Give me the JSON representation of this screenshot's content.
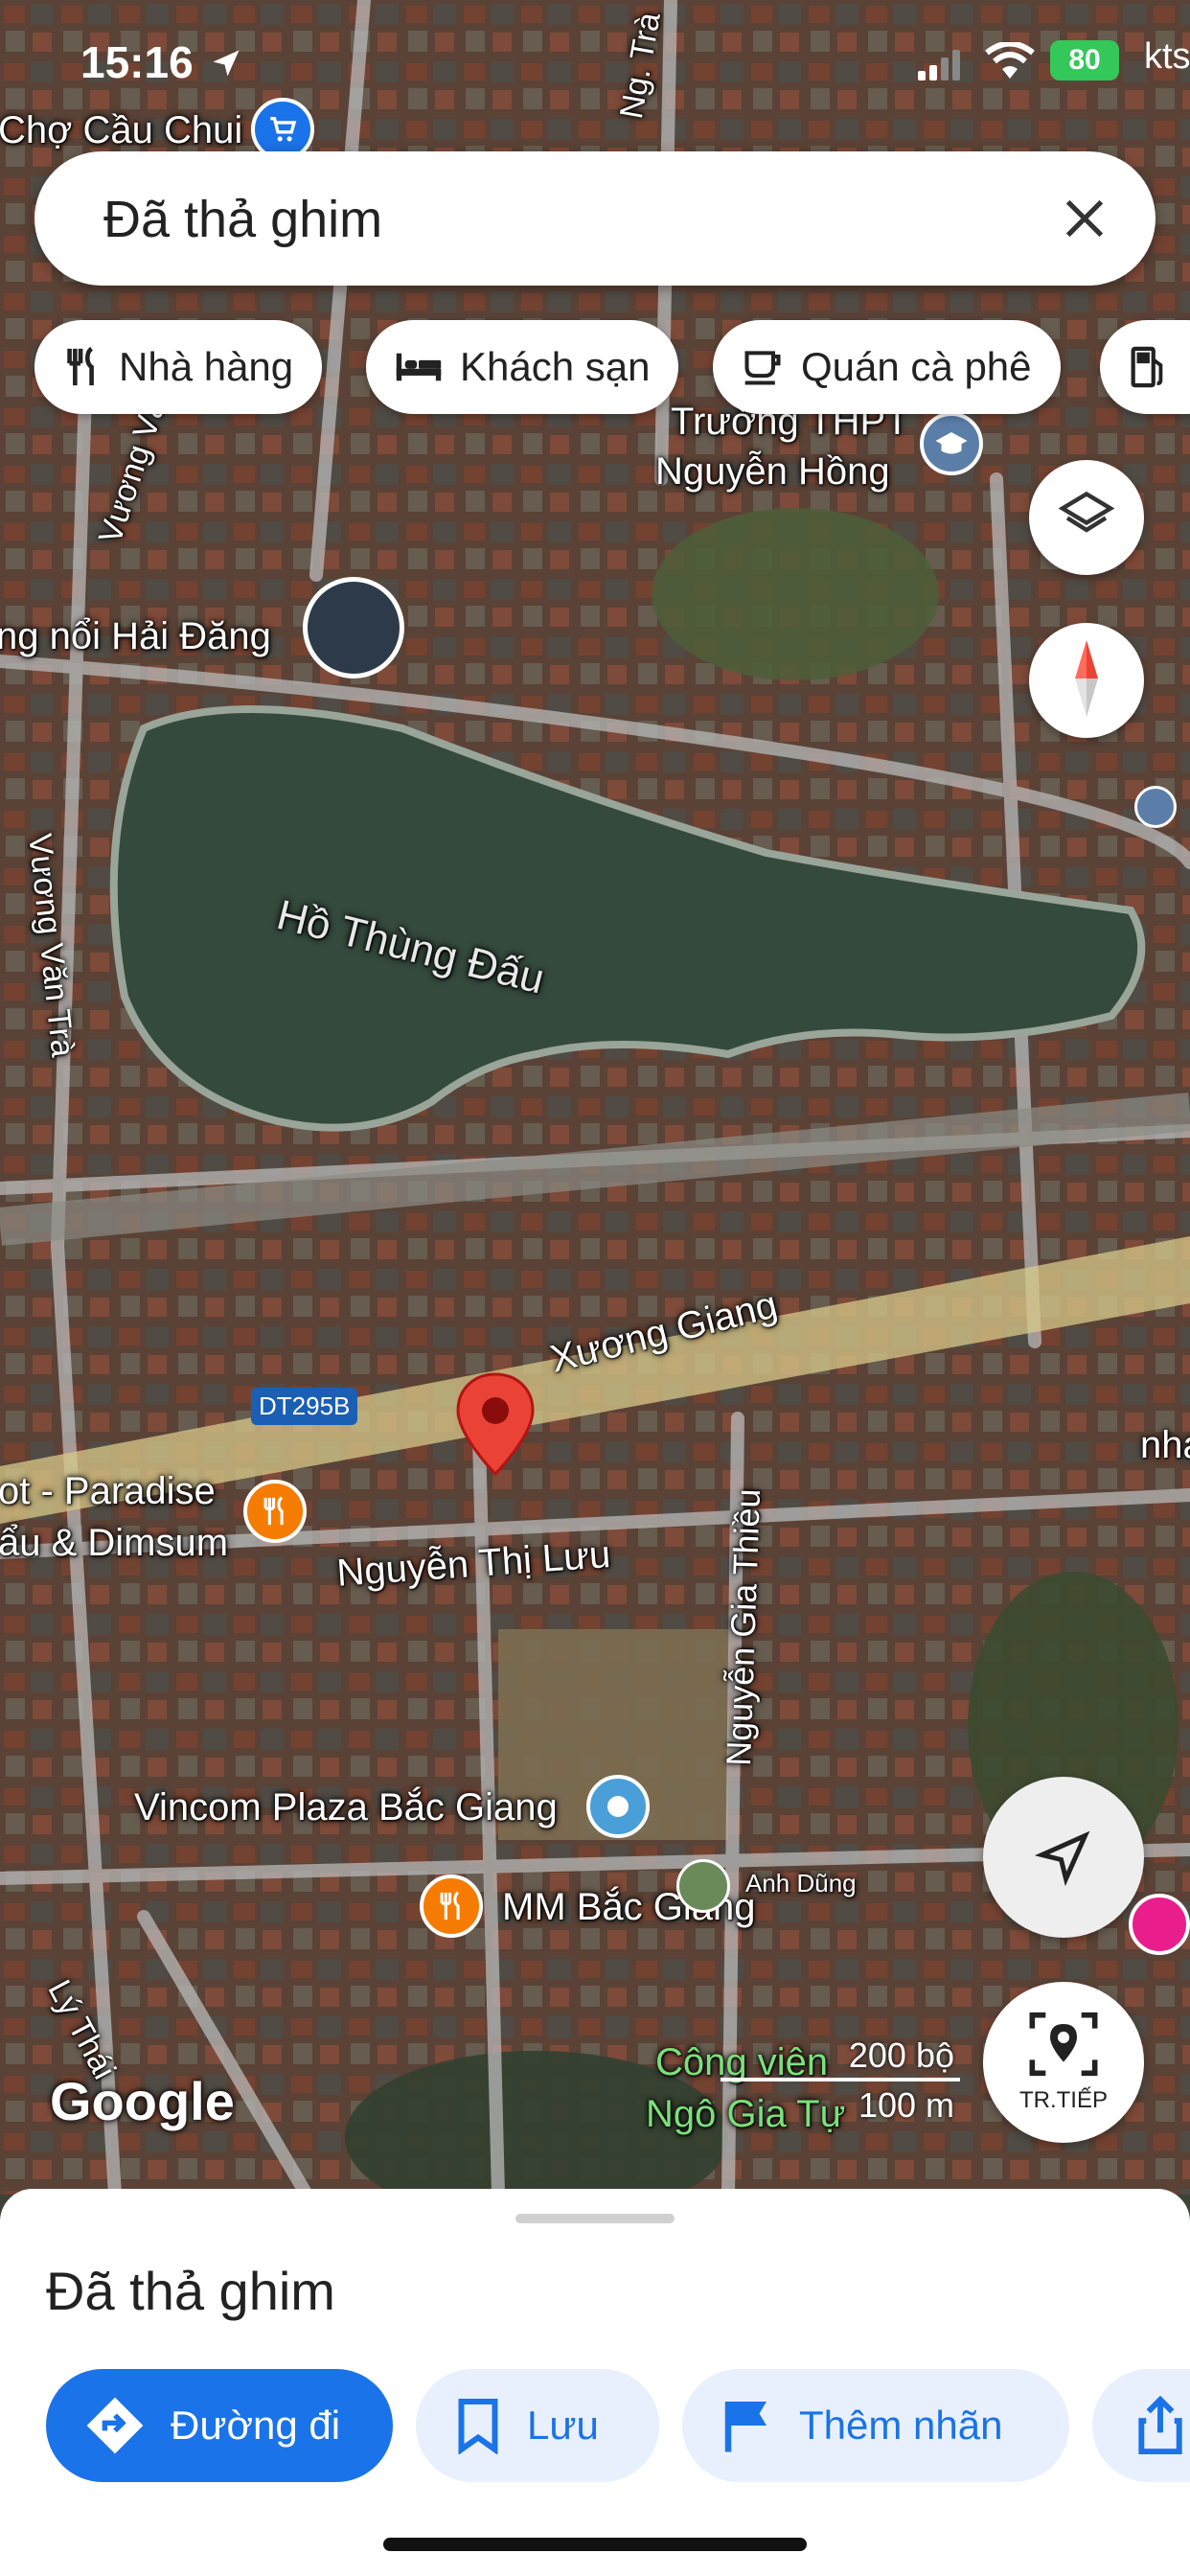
{
  "status_bar": {
    "time": "15:16",
    "battery": "80",
    "carrier": "kts"
  },
  "search": {
    "query": "Đã thả ghim"
  },
  "chips": [
    {
      "label": "Nhà hàng",
      "icon": "fork-knife-icon"
    },
    {
      "label": "Khách sạn",
      "icon": "bed-icon"
    },
    {
      "label": "Quán cà phê",
      "icon": "coffee-cup-icon"
    },
    {
      "label": "",
      "icon": "gas-station-icon"
    }
  ],
  "map_labels": {
    "cho_cau_chui": "Chợ Cầu Chui",
    "ng_tra": "Ng. Trà",
    "truong_thpt_1": "Trường THPT",
    "truong_thpt_2": "Nguyễn Hồng",
    "vuong_van_top": "Vương Vă",
    "hai_dang": "ng nổi Hải Đăng",
    "ho_thung_dau": "Hồ Thùng Đấu",
    "vuong_van_tra": "Vương Văn Trà",
    "xuong_giang": "Xương Giang",
    "dt295b": "DT295B",
    "paradise_1": "ot - Paradise",
    "paradise_2": "ẩu & Dimsum",
    "nha": "nha",
    "nguyen_thi_luu": "Nguyễn Thị Lưu",
    "nguyen_gia_thieu": "Nguyễn Gia Thiều",
    "vincom": "Vincom Plaza Bắc Giang",
    "mm_bac_giang": "MM Bắc Giang",
    "anh_dung": "Anh Dũng",
    "ly_thai": "Lý Thái",
    "cong_vien_1": "Công viên",
    "cong_vien_2": "Ngô Gia Tự"
  },
  "attribution": "Google",
  "scale": {
    "imperial": "200 bộ",
    "metric": "100 m"
  },
  "live_view_label": "TR.TIẾP",
  "sheet": {
    "title": "Đã thả ghim",
    "actions": [
      {
        "label": "Đường đi",
        "icon": "directions-icon"
      },
      {
        "label": "Lưu",
        "icon": "bookmark-icon"
      },
      {
        "label": "Thêm nhãn",
        "icon": "flag-icon"
      },
      {
        "label": "",
        "icon": "share-icon"
      }
    ]
  },
  "colors": {
    "accent": "#1a73e8",
    "pin": "#ea4335",
    "poi_orange": "#f57c00",
    "poi_blue": "#4a9fd8",
    "poi_pink": "#e91e8c",
    "road_highlight": "#d8c98a"
  }
}
